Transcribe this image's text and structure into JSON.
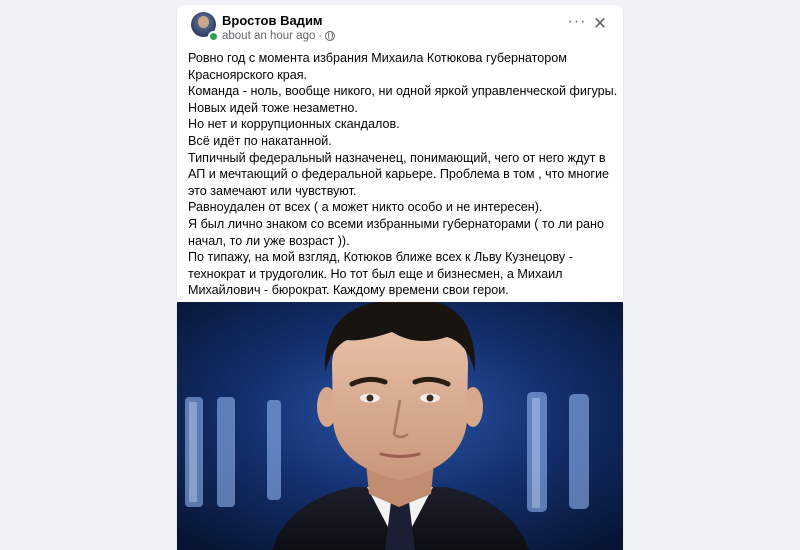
{
  "post": {
    "author": "Вростов Вадим",
    "time": "about an hour ago",
    "time_separator": "·",
    "more_icon": "ellipsis-icon",
    "close_icon": "close-icon",
    "lines": [
      "Ровно год с момента избрания Михаила Котюкова губернатором",
      "Красноярского края.",
      "Команда - ноль, вообще никого, ни одной яркой управленческой фигуры.",
      "Новых идей тоже незаметно.",
      "Но нет и коррупционных скандалов.",
      "Всё идёт по накатанной.",
      "Типичный федеральный назначенец, понимающий, чего от него ждут в",
      "АП и мечтающий о федеральной карьере. Проблема в том , что многие",
      "это замечают или чувствуют.",
      "Равноудален от всех ( а может никто особо и не интересен).",
      "Я был лично знаком со всеми избранными губернаторами ( то ли рано",
      "начал, то ли уже возраст )).",
      "По типажу, на мой взгляд, Котюков ближе всех к Льву Кузнецову -",
      "технократ и трудоголик. Но тот был еще и бизнесмен, а Михаил",
      "Михайлович - бюрократ. Каждому времени свои герои."
    ]
  },
  "colors": {
    "page_bg": "#f0f2f5",
    "card_bg": "#ffffff",
    "text": "#050505",
    "secondary_text": "#65676b",
    "online": "#31a24c",
    "photo_bg": "#0b1a3d"
  }
}
